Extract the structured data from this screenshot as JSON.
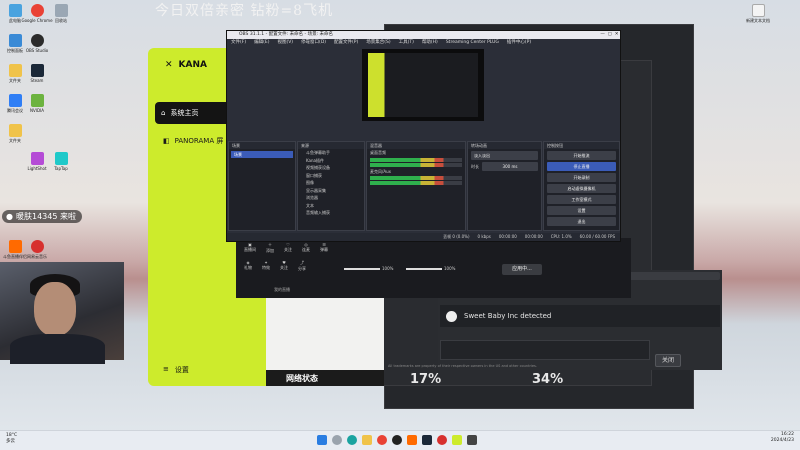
{
  "stream_title": "今日双倍亲密 钻粉=8飞机",
  "desktop_icons": [
    {
      "label": "此电脑",
      "color": "#4aa3df"
    },
    {
      "label": "Google Chrome",
      "color": "#e94235"
    },
    {
      "label": "回收站",
      "color": "#9aa7b4"
    },
    {
      "label": "控制面板",
      "color": "#3a8ad6"
    },
    {
      "label": "OBS Studio",
      "color": "#2b2b2b"
    },
    {
      "label": "Steam",
      "color": "#1b2838"
    },
    {
      "label": "文件夹",
      "color": "#f0c34a"
    },
    {
      "label": "腾讯会议",
      "color": "#2f7ef5"
    },
    {
      "label": "NVIDIA",
      "color": "#6cb33f"
    },
    {
      "label": "文件夹",
      "color": "#f0c34a"
    },
    {
      "label": "LightShot",
      "color": "#b54bd6"
    },
    {
      "label": "TapTap",
      "color": "#1fc9c9"
    },
    {
      "label": "网易云音乐",
      "color": "#d7302e"
    },
    {
      "label": "斗鱼直播伴侣",
      "color": "#ff6a00"
    }
  ],
  "right_desktop_icon": {
    "label": "新建文本文档"
  },
  "danmu_banner": {
    "text": "暖肤14345 来啦"
  },
  "kana": {
    "logo_text": "KANA",
    "nav_home": "系统主页",
    "nav_panorama": "PANORAMA 屏",
    "settings": "设置",
    "network_status": "网络状态"
  },
  "chat": {
    "detected_text": "Sweet Baby Inc detected",
    "close_label": "关闭",
    "percent_left": "17%",
    "percent_right": "34%",
    "disclaimer": "All trademarks are property of their respective owners in the US and other countries."
  },
  "obs": {
    "title": "OBS 31.1.1 - 配置文件: 未命名 - 场景: 未命名",
    "menus": [
      "文件(F)",
      "编辑(E)",
      "视图(V)",
      "停靠窗口(D)",
      "配置文件(P)",
      "场景集合(S)",
      "工具(T)",
      "帮助(H)",
      "Streaming Center PLUG",
      "插件中心(P)"
    ],
    "scenes_header": "场景",
    "scene_active": "场景",
    "sources_header": "来源",
    "sources": [
      "斗鱼弹幕助手",
      "Kana插件",
      "视频捕获设备",
      "窗口捕获",
      "图像",
      "显示器采集",
      "浏览器",
      "文本",
      "音频输入捕获"
    ],
    "mixer_header": "混音器",
    "mixer_tracks": [
      "桌面音频",
      "麦克风/Aux"
    ],
    "transitions_header": "转场动画",
    "transition_type": "淡入淡出",
    "transition_duration": "300 ms",
    "transition_duration_label": "时长",
    "controls_header": "控制按钮",
    "controls": [
      "开始推流",
      "停止直播",
      "开始录制",
      "启动虚拟摄像机",
      "工作室模式",
      "设置",
      "退出"
    ],
    "active_control_index": 1,
    "status": [
      "丢帧 0 (0.0%)",
      "0 kbps",
      "00:00:00",
      "00:00:00",
      "CPU: 1.0%",
      "60.00 / 60.00 FPS"
    ]
  },
  "sub_panel": {
    "icons": [
      "直播间",
      "添加",
      "关注",
      "连麦",
      "弹幕",
      "分享"
    ],
    "labels": [
      "礼物",
      "特效",
      "关注",
      "分享",
      "设置"
    ],
    "apply_label": "应用中...",
    "bottom_link": "我的直播",
    "mic_pct": "100%",
    "desktop_pct": "100%"
  },
  "taskbar": {
    "weather": "18°C",
    "weather_desc": "多云",
    "time": "16:22",
    "date": "2024/4/23"
  }
}
